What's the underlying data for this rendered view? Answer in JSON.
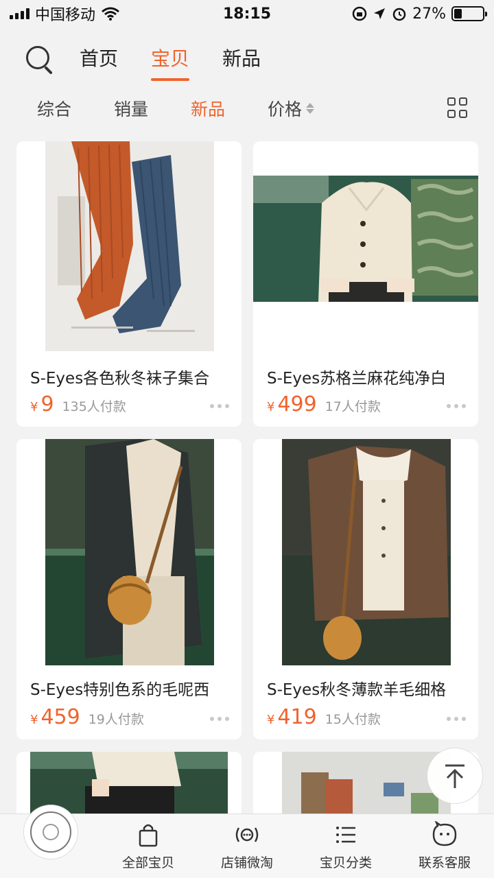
{
  "status_bar": {
    "carrier": "中国移动",
    "time": "18:15",
    "battery_percent": "27%",
    "battery_level": 0.27,
    "icons": [
      "signal-icon",
      "wifi-icon",
      "orientation-lock-icon",
      "location-icon",
      "alarm-icon",
      "battery-icon"
    ]
  },
  "nav": {
    "tabs": [
      {
        "label": "首页",
        "active": false
      },
      {
        "label": "宝贝",
        "active": true
      },
      {
        "label": "新品",
        "active": false
      }
    ]
  },
  "sort": {
    "items": [
      {
        "label": "综合",
        "active": false
      },
      {
        "label": "销量",
        "active": false
      },
      {
        "label": "新品",
        "active": true
      },
      {
        "label": "价格",
        "active": false
      }
    ]
  },
  "products": [
    {
      "title": "S-Eyes各色秋冬袜子集合",
      "currency": "¥",
      "price": "9",
      "sold": "135人付款",
      "image": "socks-photo"
    },
    {
      "title": "S-Eyes苏格兰麻花纯净白",
      "currency": "¥",
      "price": "499",
      "sold": "17人付款",
      "image": "cream-cardigan-photo"
    },
    {
      "title": "S-Eyes特别色系的毛呢西",
      "currency": "¥",
      "price": "459",
      "sold": "19人付款",
      "image": "wool-blazer-photo"
    },
    {
      "title": "S-Eyes秋冬薄款羊毛细格",
      "currency": "¥",
      "price": "419",
      "sold": "15人付款",
      "image": "tweed-jacket-photo"
    },
    {
      "image": "white-blouse-photo"
    },
    {
      "image": "gallery-wall-photo"
    }
  ],
  "bottom_bar": {
    "tabs": [
      {
        "label": "全部宝贝",
        "icon": "shopping-bag-icon"
      },
      {
        "label": "店铺微淘",
        "icon": "broadcast-icon"
      },
      {
        "label": "宝贝分类",
        "icon": "list-icon"
      },
      {
        "label": "联系客服",
        "icon": "chat-face-icon"
      }
    ]
  },
  "colors": {
    "accent": "#f0632c",
    "background": "#f2f2f2"
  }
}
